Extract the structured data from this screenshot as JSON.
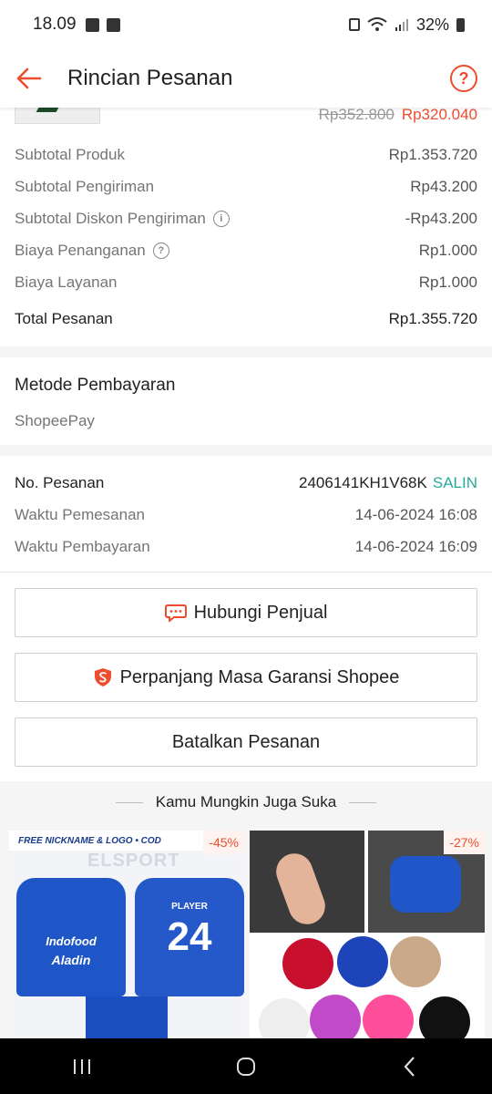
{
  "status_bar": {
    "time": "18.09",
    "battery": "32%"
  },
  "header": {
    "title": "Rincian Pesanan"
  },
  "product": {
    "original_price": "Rp352.800",
    "price": "Rp320.040"
  },
  "summary": {
    "rows": [
      {
        "label": "Subtotal Produk",
        "value": "Rp1.353.720"
      },
      {
        "label": "Subtotal Pengiriman",
        "value": "Rp43.200"
      },
      {
        "label": "Subtotal Diskon Pengiriman",
        "value": "-Rp43.200"
      },
      {
        "label": "Biaya Penanganan",
        "value": "Rp1.000"
      },
      {
        "label": "Biaya Layanan",
        "value": "Rp1.000"
      }
    ],
    "total": {
      "label": "Total Pesanan",
      "value": "Rp1.355.720"
    }
  },
  "payment": {
    "heading": "Metode Pembayaran",
    "method": "ShopeePay"
  },
  "order": {
    "number_label": "No. Pesanan",
    "number": "2406141KH1V68K",
    "copy": "SALIN",
    "order_time_label": "Waktu Pemesanan",
    "order_time": "14-06-2024 16:08",
    "payment_time_label": "Waktu Pembayaran",
    "payment_time": "14-06-2024 16:09"
  },
  "actions": {
    "contact_seller": "Hubungi Penjual",
    "extend_warranty": "Perpanjang Masa Garansi Shopee",
    "cancel_order": "Batalkan Pesanan"
  },
  "recommendations": {
    "title": "Kamu Mungkin Juga Suka",
    "items": [
      {
        "discount": "-45%",
        "banner": "FREE NICKNAME & LOGO • COD",
        "brand": "ELSPORT",
        "sponsor": "Indofood",
        "sponsor2": "Aladin",
        "player": "PLAYER",
        "number": "24"
      },
      {
        "discount": "-27%"
      }
    ]
  },
  "colors": {
    "accent": "#ee4d2d",
    "teal": "#26aa99"
  }
}
